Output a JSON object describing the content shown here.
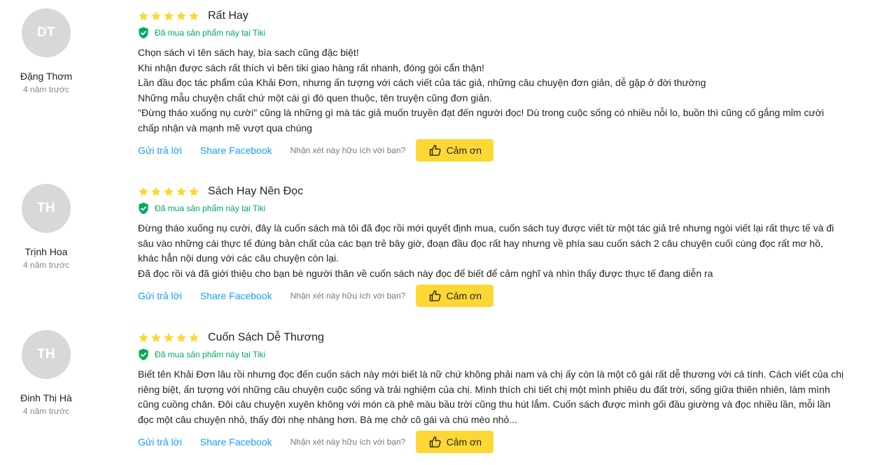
{
  "reviews": [
    {
      "author": {
        "initials": "DT",
        "name": "Đặng Thơm",
        "time": "4 năm trước"
      },
      "rating": 5,
      "title": "Rất Hay",
      "bought_text": "Đã mua sản phẩm này tại Tiki",
      "lines": [
        "Chọn sách vì tên sách hay, bìa sach cũng đặc biệt!",
        "Khi nhận được sách rất thích vì bên tiki giao hàng rất nhanh, đóng gói cẩn thận!",
        "Lần đầu đọc tác phẩm của Khải Đơn, nhưng ấn tượng với cách viết của tác giả, những câu chuyện đơn giản, dễ gặp ở đời thường",
        "Những mẫu chuyện chất chứ một cái gì đó quen thuộc, tên truyện cũng đơn giản.",
        "\"Đừng tháo xuống nụ cười\" cũng là những gì mà tác giả muốn truyền đạt đến người đọc! Dù trong cuộc sống có nhiều nỗi lo, buồn thì cũng cố gắng mỉm cười",
        "chấp nhận và mạnh mẽ vượt qua chúng"
      ]
    },
    {
      "author": {
        "initials": "TH",
        "name": "Trịnh Hoa",
        "time": "4 năm trước"
      },
      "rating": 5,
      "title": "Sách Hay Nên Đọc",
      "bought_text": "Đã mua sản phẩm này tại Tiki",
      "lines": [
        "Đừng tháo xuống nụ cười, đây là cuốn sách mà tôi đã đọc rồi mới quyết định mua, cuốn sách tuy được viết từ một tác giả trẻ nhưng ngòi viết lại rất thực tế và đi",
        "sâu vào những cái thực tế đúng bản chất của các bạn trẻ bây giờ, đoạn đầu đọc rất hay nhưng về phía sau cuốn sách 2 câu chuyện cuối cùng đọc rất mơ hồ,",
        "khác hẳn nội dung với các câu chuyện còn lại.",
        "Đã đọc rồi và đã giới thiệu cho bạn bè người thân về cuốn sách này đọc để biết để cảm nghĩ và nhìn thấy được thực tế đang diễn ra"
      ]
    },
    {
      "author": {
        "initials": "TH",
        "name": "Đinh Thị Hà",
        "time": "4 năm trước"
      },
      "rating": 5,
      "title": "Cuốn Sách Dễ Thương",
      "bought_text": "Đã mua sản phẩm này tại Tiki",
      "lines": [
        "Biết tên Khải Đơn lâu rồi nhưng đọc đến cuốn sách này mới biết là nữ chứ không phải nam và chị ấy còn là một cô gái rất dễ thương với cá tính. Cách viết của chị",
        "riêng biệt, ấn tượng với những câu chuyện cuộc sống và trải nghiệm của chị. Mình thích chi tiết chị một mình phiêu du đất trời, sống giữa thiên nhiên, làm mình",
        "cũng cuồng chân. Đôi câu chuyện xuyên không với món cà phê màu bầu trời cũng thu hút lắm. Cuốn sách được mình gối đầu giường và đọc nhiều lần, mỗi lần",
        "đọc một câu chuyện nhỏ, thấy đời nhẹ nhàng hơn. Bà mẹ chở cô gái và chú mèo nhỏ..."
      ]
    }
  ],
  "actions": {
    "reply": "Gửi trả lời",
    "share": "Share Facebook",
    "helpful_question": "Nhận xét này hữu ích với bạn?",
    "thanks": "Cảm ơn"
  },
  "colors": {
    "star": "#fdd835",
    "verified": "#00ab56",
    "link": "#189eff",
    "thanks_button": "#fdd835",
    "avatar_bg": "#d8d8d8"
  },
  "icons": [
    "star-icon",
    "shield-check-icon",
    "thumbs-up-icon"
  ]
}
